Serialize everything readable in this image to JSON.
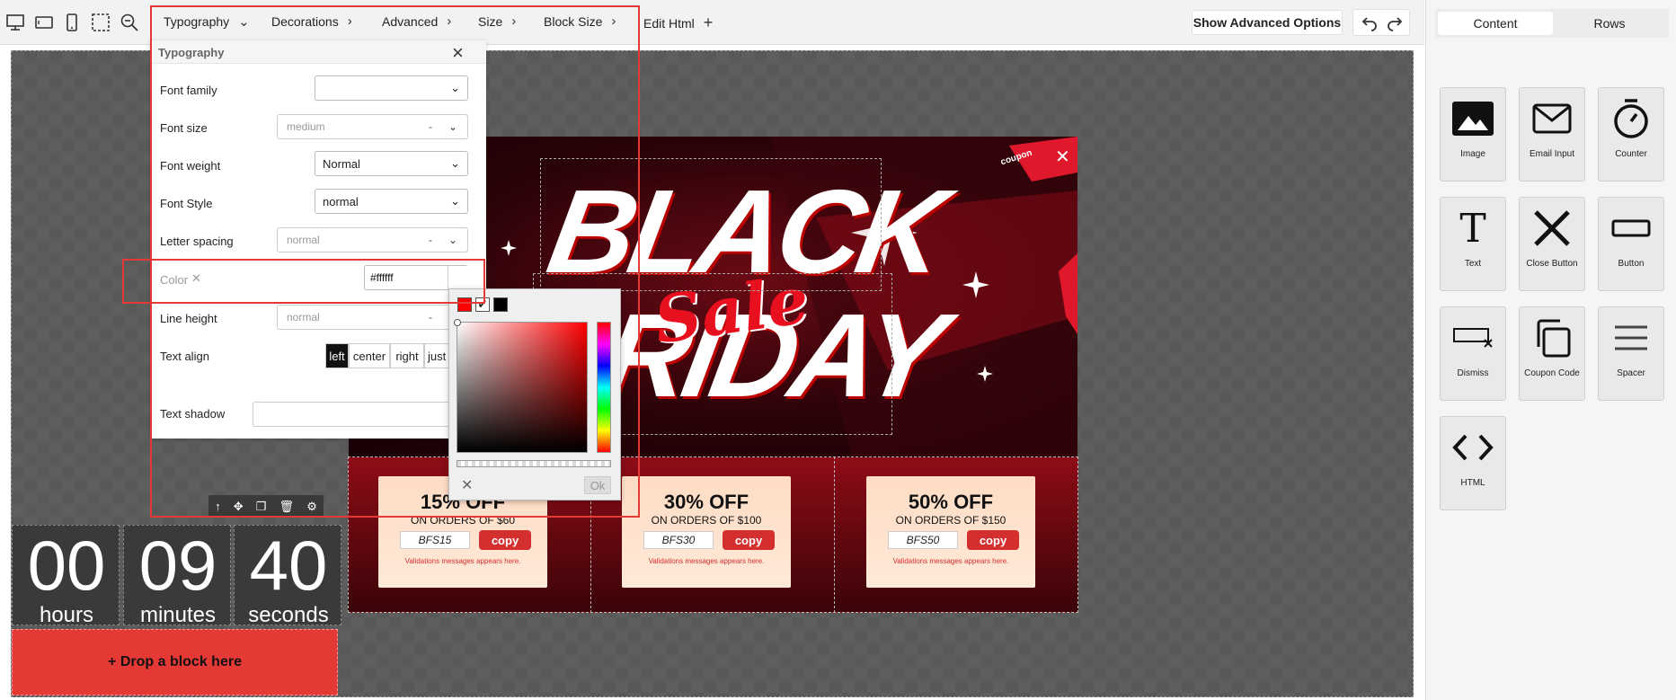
{
  "topbar": {
    "menu": [
      {
        "label": "Typography"
      },
      {
        "label": "Decorations"
      },
      {
        "label": "Advanced"
      },
      {
        "label": "Size"
      },
      {
        "label": "Block Size"
      },
      {
        "label": "Edit Html"
      }
    ],
    "advanced_button": "Show Advanced Options"
  },
  "typography_panel": {
    "title": "Typography",
    "font_family": {
      "label": "Font family",
      "value": ""
    },
    "font_size": {
      "label": "Font size",
      "placeholder": "medium",
      "unit": "-"
    },
    "font_weight": {
      "label": "Font weight",
      "value": "Normal"
    },
    "font_style": {
      "label": "Font Style",
      "value": "normal"
    },
    "letter_spacing": {
      "label": "Letter spacing",
      "placeholder": "normal",
      "unit": "-"
    },
    "color": {
      "label": "Color",
      "value": "#ffffff"
    },
    "line_height": {
      "label": "Line height",
      "placeholder": "normal",
      "unit": "-"
    },
    "text_align": {
      "label": "Text align",
      "options": [
        "left",
        "center",
        "right",
        "just"
      ]
    },
    "text_shadow": {
      "label": "Text shadow"
    }
  },
  "color_picker": {
    "swatches": [
      "#ff0000",
      "#ffffff",
      "#000000"
    ],
    "ok_label": "Ok"
  },
  "canvas": {
    "banner": {
      "line1": "BLACK",
      "script": "Sale",
      "line2": "RIDAY",
      "coupon_tag": "coupon"
    },
    "coupons": [
      {
        "title": "15% OFF",
        "subtitle": "ON ORDERS OF $60",
        "code": "BFS15",
        "copy": "copy",
        "note": "Validations messages appears here."
      },
      {
        "title": "30% OFF",
        "subtitle": "ON ORDERS OF $100",
        "code": "BFS30",
        "copy": "copy",
        "note": "Validations messages appears here."
      },
      {
        "title": "50% OFF",
        "subtitle": "ON ORDERS OF $150",
        "code": "BFS50",
        "copy": "copy",
        "note": "Validations messages appears here."
      }
    ],
    "counter": [
      {
        "value": "00",
        "unit": "hours"
      },
      {
        "value": "09",
        "unit": "minutes"
      },
      {
        "value": "40",
        "unit": "seconds"
      }
    ],
    "drop_zone": "+ Drop a block here",
    "drop_zone_color": "#e53935"
  },
  "right_panel": {
    "tabs": [
      "Content",
      "Rows"
    ],
    "blocks": [
      {
        "label": "Image",
        "icon": "image-icon"
      },
      {
        "label": "Email Input",
        "icon": "email-icon"
      },
      {
        "label": "Counter",
        "icon": "stopwatch-icon"
      },
      {
        "label": "Text",
        "icon": "text-icon"
      },
      {
        "label": "Close Button",
        "icon": "close-x-icon"
      },
      {
        "label": "Button",
        "icon": "button-icon"
      },
      {
        "label": "Dismiss",
        "icon": "dismiss-icon"
      },
      {
        "label": "Coupon Code",
        "icon": "copy-icon"
      },
      {
        "label": "Spacer",
        "icon": "spacer-icon"
      },
      {
        "label": "HTML",
        "icon": "code-icon"
      }
    ]
  },
  "colors": {
    "accent": "#e53935",
    "panel_bg": "#f5f5f5"
  }
}
